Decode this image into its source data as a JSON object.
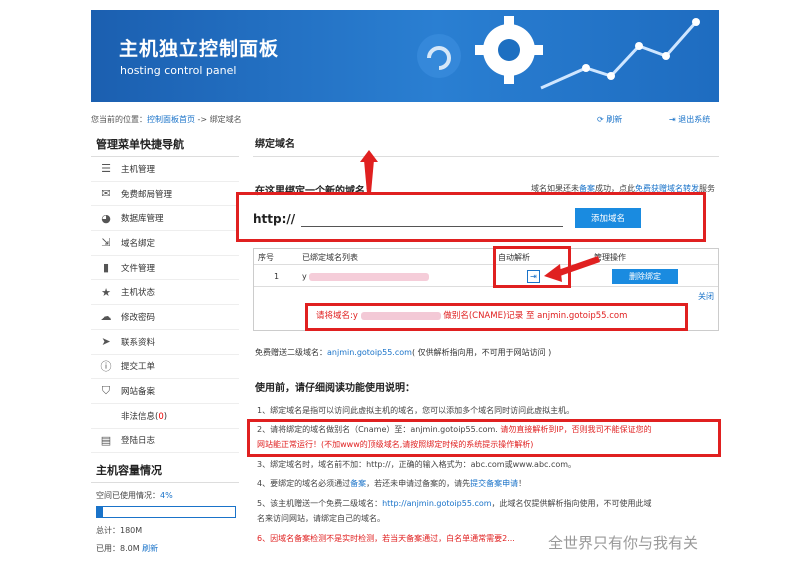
{
  "banner": {
    "title": "主机独立控制面板",
    "subtitle": "hosting control panel"
  },
  "topbar": {
    "breadcrumb_prefix": "您当前的位置：",
    "breadcrumb_link": "控制面板首页",
    "breadcrumb_sep": " -> ",
    "breadcrumb_current": "绑定域名",
    "refresh": "刷新",
    "logout": "退出系统"
  },
  "sidebar": {
    "heading": "管理菜单快捷导航",
    "items": [
      {
        "icon": "database-icon",
        "label": "主机管理"
      },
      {
        "icon": "mail-icon",
        "label": "免费邮局管理"
      },
      {
        "icon": "pie-chart-icon",
        "label": "数据库管理"
      },
      {
        "icon": "login-icon",
        "label": "域名绑定"
      },
      {
        "icon": "file-icon",
        "label": "文件管理"
      },
      {
        "icon": "star-icon",
        "label": "主机状态"
      },
      {
        "icon": "cloud-icon",
        "label": "修改密码"
      },
      {
        "icon": "send-icon",
        "label": "联系资料"
      },
      {
        "icon": "info-icon",
        "label": "提交工单"
      },
      {
        "icon": "shield-icon",
        "label": "网站备案"
      },
      {
        "icon": "",
        "label": "非法信息(",
        "count": "0",
        "suffix": ")"
      },
      {
        "icon": "doc-icon",
        "label": "登陆日志"
      }
    ],
    "capacity_heading": "主机容量情况",
    "used_label": "空间已使用情况：",
    "used_pct": "4%",
    "used_fraction": 0.04,
    "total": "总计：180M",
    "used": "已用：8.0M",
    "refresh": "刷新"
  },
  "main": {
    "heading": "绑定域名",
    "bind_heading": "在这里绑定一个新的域名：",
    "bind_note_prefix": "域名如果还未",
    "bind_note_link1": "备案",
    "bind_note_mid": "成功，点此",
    "bind_note_link2": "免费获赠域名转发",
    "bind_note_suffix": "服务",
    "http_label": "http://",
    "domain_input_value": "",
    "add_button": "添加域名",
    "table": {
      "headers": [
        "序号",
        "已绑定域名列表",
        "自动解析",
        "管理操作"
      ],
      "row_index": "1",
      "row_domain": "y",
      "delete_button": "删除绑定",
      "close_link": "关闭",
      "cname_prefix": "请将域名:y",
      "cname_suffix": "做别名(CNAME)记录 至 anjmin.gotoip55.com"
    },
    "free_prefix": "免费赠送二级域名：",
    "free_link": "anjmin.gotoip55.com",
    "free_suffix": "( 仅供解析指向用，不可用于网站访问 )",
    "before_heading": "使用前，请仔细阅读功能使用说明：",
    "notes": {
      "n1": "1、绑定域名是指可以访问此虚拟主机的域名，您可以添加多个域名同时访问此虚拟主机。",
      "n2_a": "2、请将绑定的域名做别名（Cname）至：anjmin.gotoip55.com. ",
      "n2_red": "请勿直接解析到IP，否则我司不能保证您的",
      "n2_red2": "网站能正常运行！(不加www的顶级域名,请按照绑定时候的系统提示操作解析)",
      "n3": "3、绑定域名时，域名前不加：http://，正确的输入格式为：abc.com或www.abc.com。",
      "n4_a": "4、要绑定的域名必须通过",
      "n4_link1": "备案",
      "n4_b": "，若还未申请过备案的，请先",
      "n4_link2": "提交备案申请",
      "n4_c": "！",
      "n5_a": "5、该主机赠送一个免费二级域名：",
      "n5_link": "http://anjmin.gotoip55.com",
      "n5_b": "，此域名仅提供解析指向使用，不可使用此域",
      "n5_c": "名来访问网站，请绑定自己的域名。",
      "n6": "6、因域名备案检测不是实时检测，若当天备案通过，白名单通常需要2..."
    }
  },
  "watermark": "全世界只有你与我有关",
  "colors": {
    "accent": "#1a73c9",
    "button": "#1a8be0",
    "alert": "#e02020",
    "banner": "#1d6fc1"
  }
}
